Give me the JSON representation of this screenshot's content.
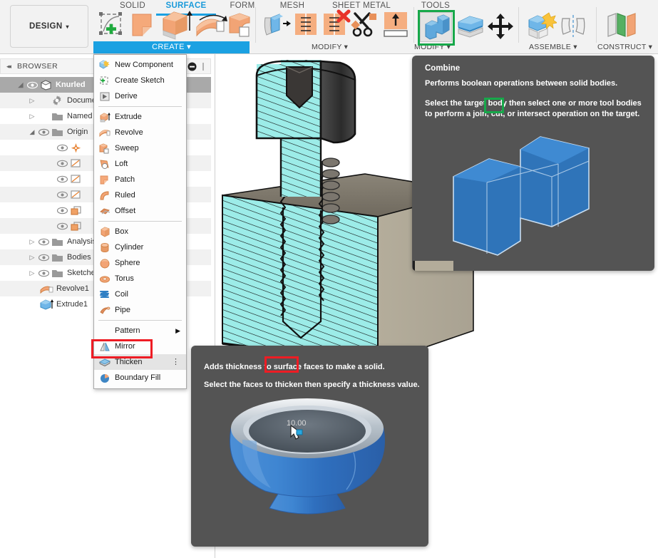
{
  "app": {
    "workspace_button": "DESIGN",
    "caret": "▾"
  },
  "ribbon": {
    "tabs": [
      {
        "label": "SOLID",
        "active": false
      },
      {
        "label": "SURFACE",
        "active": true
      },
      {
        "label": "FORM",
        "active": false
      },
      {
        "label": "MESH",
        "active": false
      },
      {
        "label": "SHEET METAL",
        "active": false
      },
      {
        "label": "TOOLS",
        "active": false
      }
    ],
    "panels": [
      {
        "label": "CREATE ▾",
        "name": "create-panel-label",
        "active": true
      },
      {
        "label": "MODIFY ▾",
        "name": "modify-panel-label-1",
        "active": false
      },
      {
        "label": "MODIFY ▾",
        "name": "modify-panel-label-2",
        "active": false
      },
      {
        "label": "ASSEMBLE ▾",
        "name": "assemble-panel-label",
        "active": false
      },
      {
        "label": "CONSTRUCT ▾",
        "name": "construct-panel-label",
        "active": false
      }
    ],
    "buttons": [
      {
        "name": "create-sketch-icon",
        "title": "Create Sketch"
      },
      {
        "name": "patch-icon",
        "title": "Patch"
      },
      {
        "name": "extrude-icon",
        "title": "Extrude"
      },
      {
        "name": "revolve-icon",
        "title": "Revolve"
      },
      {
        "name": "sweep-icon",
        "title": "Sweep"
      },
      {
        "name": "trim-icon",
        "title": "Trim"
      },
      {
        "name": "extend-icon",
        "title": "Extend"
      },
      {
        "name": "stitch-icon",
        "title": "Stitch"
      },
      {
        "name": "unstitch-icon",
        "title": "Unstitch"
      },
      {
        "name": "split-face-icon",
        "title": "Split Face"
      },
      {
        "name": "combine-icon",
        "title": "Combine"
      },
      {
        "name": "offset-face-icon",
        "title": "Offset Face"
      },
      {
        "name": "move-copy-icon",
        "title": "Move/Copy"
      },
      {
        "name": "new-component-icon",
        "title": "New Component"
      },
      {
        "name": "mirror-icon",
        "title": "Mirror"
      },
      {
        "name": "offset-plane-icon",
        "title": "Offset Plane"
      }
    ]
  },
  "browser": {
    "header": "BROWSER",
    "collapse_icon": "◂◂",
    "tree": [
      {
        "label": "Knurled",
        "indent": 0,
        "arrow": "open",
        "eye": true,
        "icon": "component-icon",
        "selected": true,
        "name": "tree-item-knurled"
      },
      {
        "label": "Document Settings",
        "indent": 1,
        "arrow": "closed",
        "eye": false,
        "icon": "gear-icon",
        "selected": false,
        "name": "tree-item-document-settings"
      },
      {
        "label": "Named Views",
        "indent": 1,
        "arrow": "closed",
        "eye": false,
        "icon": "folder-icon",
        "selected": false,
        "name": "tree-item-named-views"
      },
      {
        "label": "Origin",
        "indent": 1,
        "arrow": "open",
        "eye": true,
        "icon": "folder-icon",
        "selected": false,
        "name": "tree-item-origin"
      },
      {
        "label": "",
        "indent": 2,
        "arrow": "none",
        "eye": true,
        "icon": "origin-point-icon",
        "selected": false,
        "name": "tree-item-origin-point"
      },
      {
        "label": "",
        "indent": 2,
        "arrow": "none",
        "eye": true,
        "icon": "plane-icon",
        "selected": false,
        "name": "tree-item-plane-xy"
      },
      {
        "label": "",
        "indent": 2,
        "arrow": "none",
        "eye": true,
        "icon": "plane-icon",
        "selected": false,
        "name": "tree-item-plane-xz"
      },
      {
        "label": "",
        "indent": 2,
        "arrow": "none",
        "eye": true,
        "icon": "plane-icon",
        "selected": false,
        "name": "tree-item-plane-yz"
      },
      {
        "label": "",
        "indent": 2,
        "arrow": "none",
        "eye": true,
        "icon": "sketch-icon",
        "selected": false,
        "name": "tree-item-sketch-a"
      },
      {
        "label": "",
        "indent": 2,
        "arrow": "none",
        "eye": true,
        "icon": "sketch-icon",
        "selected": false,
        "name": "tree-item-sketch-b"
      },
      {
        "label": "Analysis",
        "indent": 1,
        "arrow": "closed",
        "eye": true,
        "icon": "folder-icon",
        "selected": false,
        "name": "tree-item-analysis"
      },
      {
        "label": "Bodies",
        "indent": 1,
        "arrow": "closed",
        "eye": true,
        "icon": "folder-icon",
        "selected": false,
        "name": "tree-item-bodies"
      },
      {
        "label": "Sketches",
        "indent": 1,
        "arrow": "closed",
        "eye": true,
        "icon": "folder-icon",
        "selected": false,
        "name": "tree-item-sketches"
      },
      {
        "label": "Revolve1",
        "indent": 1,
        "arrow": "none",
        "eye": false,
        "icon": "revolve-feature-icon",
        "selected": false,
        "name": "tree-item-revolve1"
      },
      {
        "label": "Extrude1",
        "indent": 1,
        "arrow": "none",
        "eye": false,
        "icon": "extrude-feature-icon",
        "selected": false,
        "name": "tree-item-extrude1"
      }
    ]
  },
  "create_menu": {
    "items": [
      {
        "label": "New Component",
        "icon": "new-component-icon",
        "type": "item"
      },
      {
        "label": "Create Sketch",
        "icon": "create-sketch-icon",
        "type": "item"
      },
      {
        "label": "Derive",
        "icon": "derive-icon",
        "type": "item"
      },
      {
        "type": "separator",
        "label": "",
        "icon": ""
      },
      {
        "label": "Extrude",
        "icon": "extrude-icon",
        "type": "item"
      },
      {
        "label": "Revolve",
        "icon": "revolve-icon",
        "type": "item"
      },
      {
        "label": "Sweep",
        "icon": "sweep-icon",
        "type": "item"
      },
      {
        "label": "Loft",
        "icon": "loft-icon",
        "type": "item"
      },
      {
        "label": "Patch",
        "icon": "patch-icon",
        "type": "item"
      },
      {
        "label": "Ruled",
        "icon": "ruled-icon",
        "type": "item"
      },
      {
        "label": "Offset",
        "icon": "offset-icon",
        "type": "item"
      },
      {
        "type": "separator",
        "label": "",
        "icon": ""
      },
      {
        "label": "Box",
        "icon": "box-icon",
        "type": "item"
      },
      {
        "label": "Cylinder",
        "icon": "cylinder-icon",
        "type": "item"
      },
      {
        "label": "Sphere",
        "icon": "sphere-icon",
        "type": "item"
      },
      {
        "label": "Torus",
        "icon": "torus-icon",
        "type": "item"
      },
      {
        "label": "Coil",
        "icon": "coil-icon",
        "type": "item"
      },
      {
        "label": "Pipe",
        "icon": "pipe-icon",
        "type": "item"
      },
      {
        "type": "separator",
        "label": "",
        "icon": ""
      },
      {
        "label": "Pattern",
        "icon": "none",
        "type": "submenu"
      },
      {
        "label": "Mirror",
        "icon": "mirror-icon",
        "type": "item"
      },
      {
        "label": "Thicken",
        "icon": "thicken-icon",
        "type": "item",
        "highlighted": true,
        "overflow": "⋮"
      },
      {
        "label": "Boundary Fill",
        "icon": "boundary-fill-icon",
        "type": "item"
      }
    ],
    "submenu_arrow": "▶"
  },
  "tooltips": {
    "combine": {
      "title": "Combine",
      "line1": "Performs boolean operations between solid bodies.",
      "line2": "Select the target body then select one or more tool bodies",
      "line3": "to perform a join, cut, or intersect operation on the target.",
      "highlight_word": "cut,",
      "highlight_color": "#17a84a"
    },
    "thicken": {
      "line1": "Adds thickness to surface faces to make a solid.",
      "line2": "Select the faces to thicken then specify a thickness value.",
      "highlight_word": "surface f",
      "highlight_color": "#ee1c24",
      "dimension_label": "10.00"
    }
  },
  "annotations": {
    "combine_button_box_color": "#17a84a",
    "thicken_menu_box_color": "#ee1c24"
  },
  "colors": {
    "accent_blue": "#1ba1e2",
    "panel_bg": "#f2f2f2",
    "tooltip_bg": "#545454",
    "section_cyan": "#9cece8",
    "body_tan": "#b3ac9a",
    "preview_blue": "#2a72c0"
  }
}
